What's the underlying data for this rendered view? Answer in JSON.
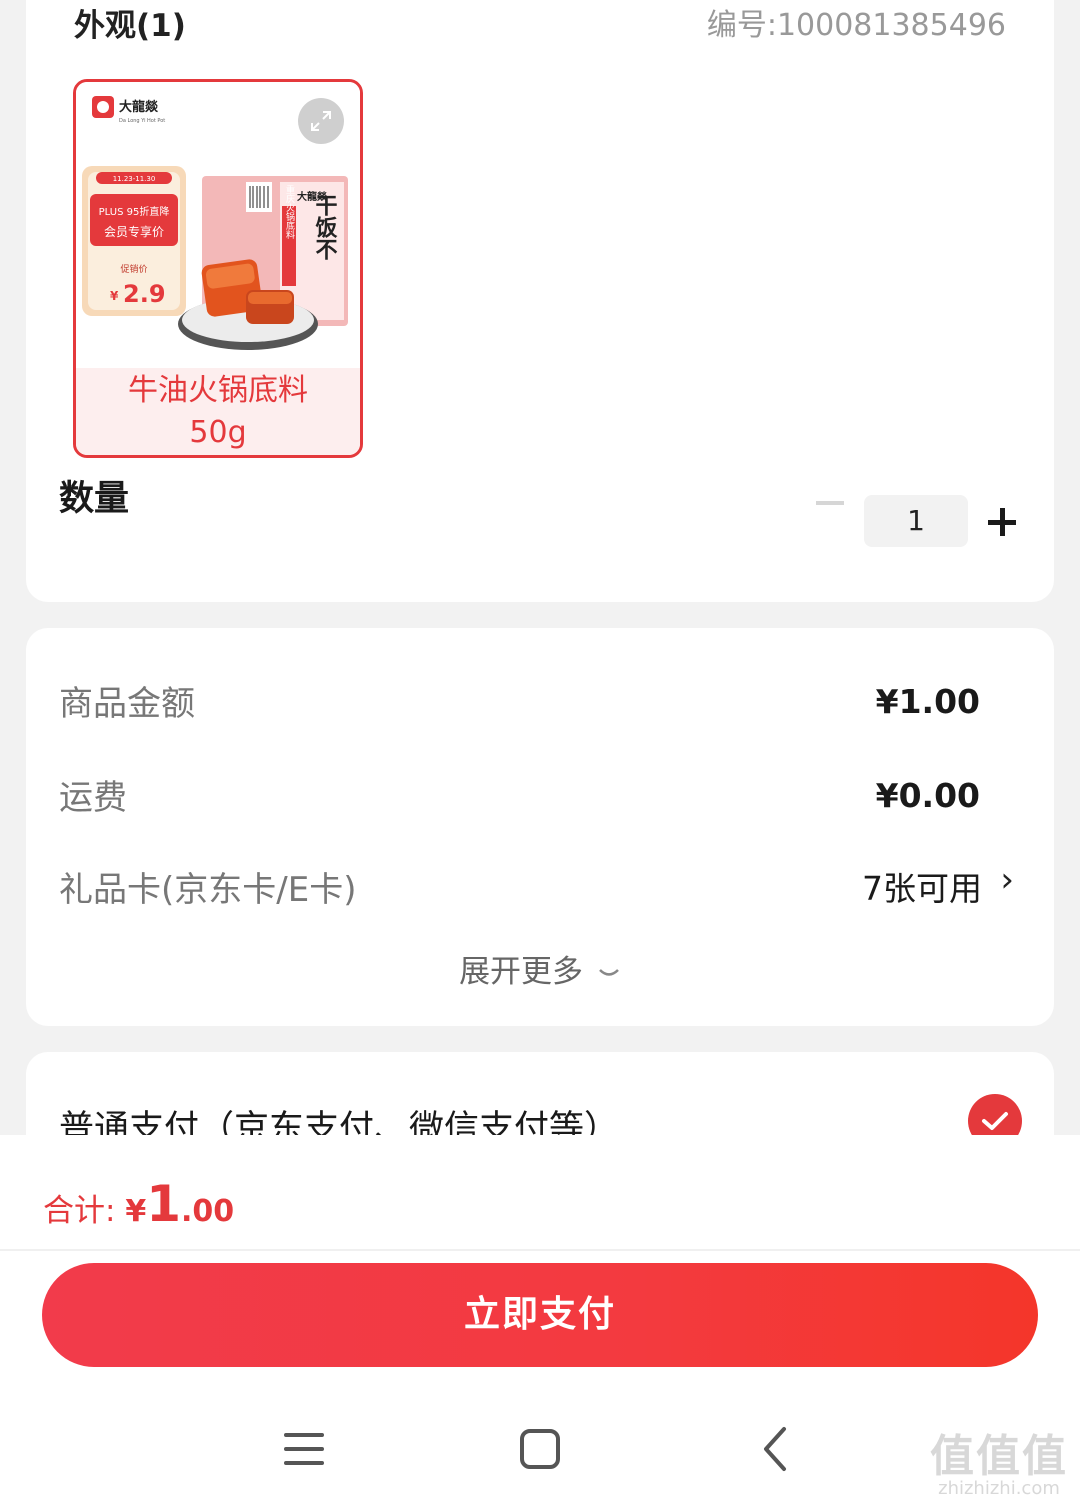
{
  "product_card": {
    "appearance_title": "外观(1)",
    "product_code": "编号:100081385496",
    "variant": {
      "name_line1": "牛油火锅底料",
      "name_line2": "50g",
      "image_brand": "大龍燚",
      "image_brand_en": "Da Long Yi Hot Pot",
      "image_promo_dates": "11.23-11.30",
      "image_promo_title": "PLUS 95折直降",
      "image_promo_sub": "会员专享价",
      "image_promo_price_label": "促销价",
      "image_promo_price_currency": "¥",
      "image_promo_price": "2.9",
      "image_pack_slogan": "干饭不",
      "image_pack_side": "重庆火锅底料"
    },
    "quantity_label": "数量",
    "quantity_value": "1"
  },
  "price_card": {
    "goods_amount_label": "商品金额",
    "goods_amount_value": "¥1.00",
    "shipping_label": "运费",
    "shipping_value": "¥0.00",
    "giftcard_label": "礼品卡(京东卡/E卡)",
    "giftcard_value": "7张可用",
    "expand_more": "展开更多"
  },
  "payment_card": {
    "method_label": "普通支付（京东支付、微信支付等）"
  },
  "bottom_bar": {
    "total_label": "合计: ",
    "total_currency": "¥",
    "total_int": "1",
    "total_dec": ".00",
    "pay_button": "立即支付"
  },
  "watermark": {
    "big": "值值值",
    "small": "zhizhizhi.com"
  },
  "colors": {
    "accent": "#e4393c",
    "page_bg": "#f2f2f2",
    "card_bg": "#ffffff"
  }
}
